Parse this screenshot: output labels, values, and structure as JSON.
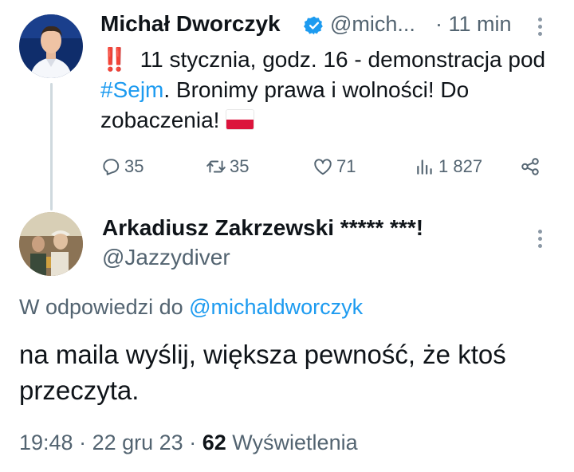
{
  "original_tweet": {
    "author_name": "Michał Dworczyk",
    "author_handle": "@mich...",
    "separator": "·",
    "time_ago": "11 min",
    "emoji_prefix": "‼️",
    "text_part1": " 11 stycznia, godz. 16 - demonstracja pod ",
    "hashtag": "#Sejm",
    "text_part2": ". Bronimy prawa i wolności! Do zobaczenia!",
    "emoji_suffix": "🇵🇱",
    "stats": {
      "replies": "35",
      "retweets": "35",
      "likes": "71",
      "views": "1 827"
    }
  },
  "reply_tweet": {
    "author_name": "Arkadiusz Zakrzewski ***** ***!",
    "author_handle": "@Jazzydiver",
    "reply_to_label": "W odpowiedzi do",
    "reply_to_handle": "@michaldworczyk",
    "text": "na maila wyślij, większa pewność, że ktoś przeczyta.",
    "time": "19:48",
    "dot1": "·",
    "date": "22 gru 23",
    "dot2": "·",
    "views_count": "62",
    "views_label": "Wyświetlenia"
  },
  "colors": {
    "accent": "#1d9bf0",
    "secondary_text": "#536471",
    "primary_text": "#0f1419",
    "thread_line": "#cfd9de"
  },
  "icons": [
    "verified-badge-icon",
    "reply-icon",
    "retweet-icon",
    "like-icon",
    "views-icon",
    "share-icon",
    "more-icon"
  ]
}
